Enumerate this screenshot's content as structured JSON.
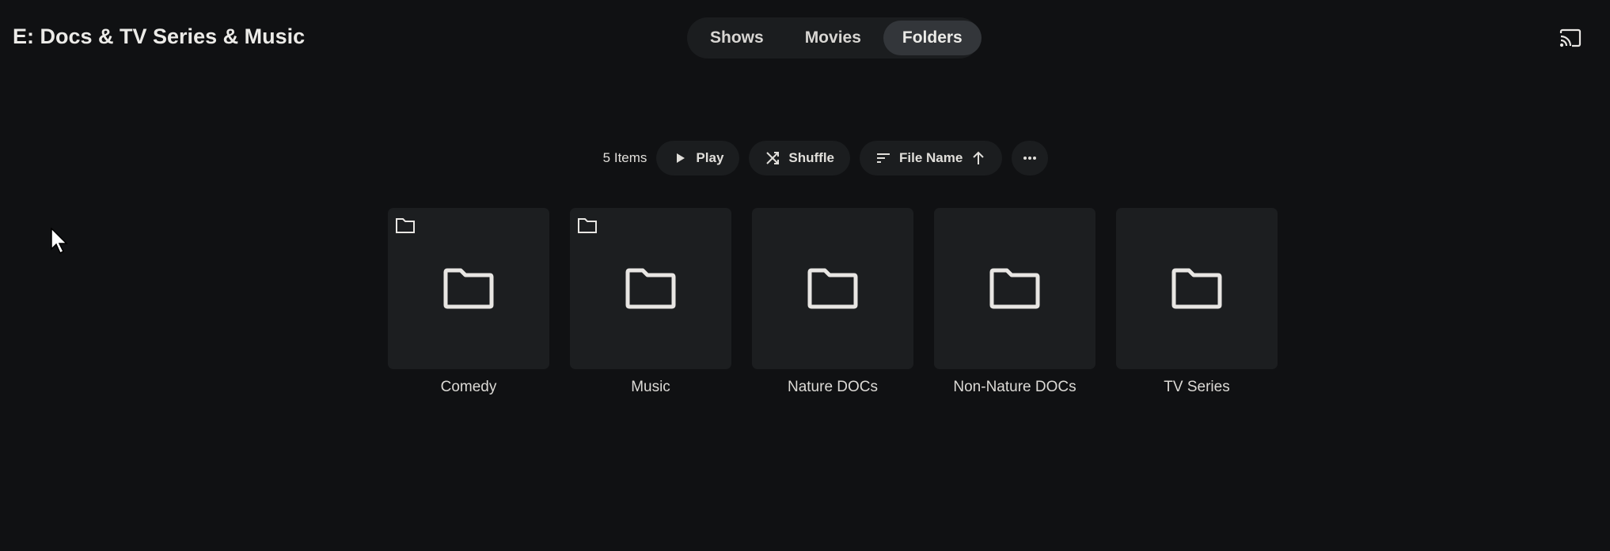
{
  "header": {
    "title": "E: Docs & TV Series & Music",
    "cast_icon": "cast-icon"
  },
  "tabs": [
    {
      "label": "Shows"
    },
    {
      "label": "Movies"
    },
    {
      "label": "Folders",
      "active": true
    }
  ],
  "toolbar": {
    "item_count": "5 Items",
    "play": "Play",
    "shuffle": "Shuffle",
    "sort": "File Name",
    "sort_direction": "ascending"
  },
  "folders": [
    {
      "name": "Comedy"
    },
    {
      "name": "Music"
    },
    {
      "name": "Nature DOCs"
    },
    {
      "name": "Non-Nature DOCs"
    },
    {
      "name": "TV Series"
    }
  ]
}
